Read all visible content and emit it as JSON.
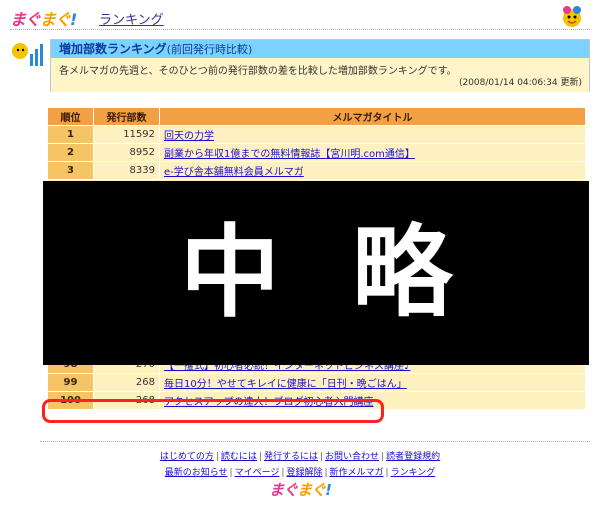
{
  "header": {
    "logo_text": "まぐまぐ!",
    "ranking_link": "ランキング"
  },
  "info": {
    "title": "増加部数ランキング",
    "subtitle": "(前回発行時比較)",
    "description": "各メルマガの先週と、そのひとつ前の発行部数の差を比較した増加部数ランキングです。",
    "updated": "(2008/01/14 04:06:34 更新)"
  },
  "table": {
    "headers": {
      "rank": "順位",
      "count": "発行部数",
      "title": "メルマガタイトル"
    },
    "rows": [
      {
        "rank": "1",
        "count": "11592",
        "title": "回天の力学"
      },
      {
        "rank": "2",
        "count": "8952",
        "title": "副業から年収1億までの無料情報誌【宮川明.com通信】"
      },
      {
        "rank": "3",
        "count": "8339",
        "title": "e-学び舎本舗無料会員メルマガ"
      },
      {
        "rank": "98",
        "count": "270",
        "title": "【一攫式】初心者必読！インターネットビジネス講座♪"
      },
      {
        "rank": "99",
        "count": "268",
        "title": "毎日10分！やせてキレイに健康に「日刊・晩ごはん」"
      },
      {
        "rank": "100",
        "count": "268",
        "title": "アクセスアップの達人！ブログ初心者入門講座"
      }
    ]
  },
  "omission": {
    "label": "中略"
  },
  "footer": {
    "row1": [
      "はじめての方",
      "読むには",
      "発行するには",
      "お問い合わせ",
      "読者登録規約"
    ],
    "row2": [
      "最新のお知らせ",
      "マイページ",
      "登録解除",
      "新作メルマガ",
      "ランキング"
    ],
    "logo_text": "まぐまぐ!"
  },
  "colors": {
    "header_bg": "#f2a044",
    "row_bg": "#fff1bf",
    "rank_bg": "#f5c565",
    "info_title_bg": "#7cd2ff",
    "info_body_bg": "#fff5c8",
    "link": "#1a0fd1",
    "highlight": "#ff2020"
  }
}
